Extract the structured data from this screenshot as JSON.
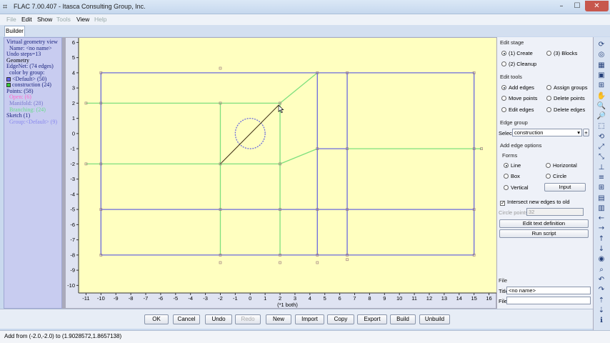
{
  "window": {
    "title": "FLAC 7.00.407 - Itasca Consulting Group, Inc.",
    "app_icon": "flac-app-icon",
    "minimize_glyph": "–",
    "maximize_glyph": "☐",
    "close_glyph": "✕"
  },
  "menu": [
    "File",
    "Edit",
    "Show",
    "Tools",
    "View",
    "Help"
  ],
  "menu_disabled": [
    "File",
    "Tools",
    "Help"
  ],
  "tabs": [
    "Builder"
  ],
  "left_panel": {
    "lines": [
      {
        "text": "Virtual geometry view",
        "color": "#1a237e"
      },
      {
        "text": "Name: <no name>",
        "color": "#1a237e",
        "indent": true
      },
      {
        "text": "Undo steps=13",
        "color": "#1a237e"
      },
      {
        "text": "Geometry",
        "color": "#000000"
      },
      {
        "text": "EdgeNet: (74 edges)",
        "color": "#1a237e"
      },
      {
        "text": "color by group:",
        "color": "#1a237e",
        "indent": true
      },
      {
        "text": "<Default> (50)",
        "color": "#1a237e",
        "swatch": "#6666ee"
      },
      {
        "text": "construction (24)",
        "color": "#1a237e",
        "swatch": "#33cc33"
      },
      {
        "text": "Points: (58)",
        "color": "#1a237e"
      },
      {
        "text": "Open: (6)",
        "color": "#ff66cc",
        "indent": true
      },
      {
        "text": "Manifold: (28)",
        "color": "#7777cc",
        "indent": true
      },
      {
        "text": "Branching: (24)",
        "color": "#66dd88",
        "indent": true
      },
      {
        "text": "Sketch (1)",
        "color": "#1a237e"
      },
      {
        "text": "Group:<Default> (9)",
        "color": "#8888ee",
        "indent": true
      }
    ]
  },
  "plot": {
    "x_ticks": [
      "-11",
      "-10",
      "-9",
      "-8",
      "-7",
      "-6",
      "-5",
      "-4",
      "-3",
      "-2",
      "-1",
      "0",
      "1",
      "2",
      "3",
      "4",
      "5",
      "6",
      "7",
      "8",
      "9",
      "10",
      "11",
      "12",
      "13",
      "14",
      "15",
      "16"
    ],
    "y_ticks": [
      "6",
      "5",
      "4",
      "3",
      "2",
      "1",
      "0",
      "-1",
      "-2",
      "-3",
      "-4",
      "-5",
      "-6",
      "-7",
      "-8",
      "-9",
      "-10"
    ],
    "x_note": "(*1 both)",
    "colors": {
      "background": "#ffffc0",
      "default_edge": "#6a6ade",
      "construction_edge": "#7ee07e",
      "sketch_line": "#3a2a10",
      "point_marker": "#a08080"
    }
  },
  "right_panel": {
    "edit_stage_title": "Edit stage",
    "edit_stage": [
      {
        "label": "(1) Create",
        "checked": true
      },
      {
        "label": "(3) Blocks",
        "checked": false
      },
      {
        "label": "(2) Cleanup",
        "checked": false
      }
    ],
    "edit_tools_title": "Edit tools",
    "edit_tools": [
      {
        "label": "Add edges",
        "checked": true
      },
      {
        "label": "Assign groups",
        "checked": false
      },
      {
        "label": "Move points",
        "checked": false
      },
      {
        "label": "Delete points",
        "checked": false
      },
      {
        "label": "Edit edges",
        "checked": false
      },
      {
        "label": "Delete edges",
        "checked": false
      }
    ],
    "edge_group_title": "Edge group",
    "select_label": "Select",
    "select_value": "construction",
    "add_button": "+",
    "add_edge_options_title": "Add edge options",
    "forms_title": "Forms",
    "forms": [
      {
        "label": "Line",
        "checked": true
      },
      {
        "label": "Horizontal",
        "checked": false
      },
      {
        "label": "Box",
        "checked": false
      },
      {
        "label": "Circle",
        "checked": false
      },
      {
        "label": "Vertical",
        "checked": false
      }
    ],
    "input_button": "Input",
    "intersect_label": "Intersect new edges to old",
    "intersect_checked": true,
    "circle_points_label": "Circle points",
    "circle_points_value": "32",
    "edit_text_button": "Edit text definition",
    "run_script_button": "Run script",
    "file_title": "File",
    "title_label": "Title",
    "title_value": "<no name>",
    "file_label": "File",
    "file_value": ""
  },
  "toolbar_icons": [
    "refresh-icon",
    "reset-view-icon",
    "view-icon",
    "grid-icon",
    "select-icon",
    "pan-icon",
    "zoom-in-icon",
    "zoom-out-icon",
    "zoom-box-icon",
    "rotate-icon",
    "fit-icon",
    "fit-all-icon",
    "axes-icon",
    "layer-icon",
    "grid-plot-icon",
    "mesh-icon",
    "table-icon",
    "arrow-left-icon",
    "arrow-right-icon",
    "up-arrow-icon",
    "down-arrow-icon",
    "target-icon",
    "search-icon",
    "undo-view-icon",
    "redo-view-icon",
    "up-icon",
    "down-icon",
    "info-icon"
  ],
  "toolbar_glyphs": [
    "⟳",
    "◎",
    "▦",
    "▣",
    "⊞",
    "✋",
    "🔍",
    "🔎",
    "⬚",
    "⟲",
    "⤢",
    "⤡",
    "⊥",
    "≡",
    "⊞",
    "▤",
    "▥",
    "←",
    "→",
    "↑",
    "↓",
    "◉",
    "⌕",
    "↶",
    "↷",
    "⇡",
    "⇣",
    "ℹ"
  ],
  "bottom_buttons": [
    {
      "label": "OK",
      "enabled": true
    },
    {
      "label": "Cancel",
      "enabled": true
    },
    {
      "label": "Undo",
      "enabled": true
    },
    {
      "label": "Redo",
      "enabled": false
    },
    {
      "label": "New",
      "enabled": true
    },
    {
      "label": "Import",
      "enabled": true
    },
    {
      "label": "Copy",
      "enabled": true
    },
    {
      "label": "Export",
      "enabled": true
    },
    {
      "label": "Build",
      "enabled": true
    },
    {
      "label": "Unbuild",
      "enabled": true
    }
  ],
  "status": "Add from (-2.0,-2.0) to (1.9028572,1.8657138)",
  "geometry": {
    "default_edges": [
      [
        [
          -10,
          4
        ],
        [
          15,
          4
        ]
      ],
      [
        [
          15,
          4
        ],
        [
          15,
          -8
        ]
      ],
      [
        [
          15,
          -8
        ],
        [
          -10,
          -8
        ]
      ],
      [
        [
          -10,
          -8
        ],
        [
          -10,
          4
        ]
      ],
      [
        [
          -10,
          -5
        ],
        [
          15,
          -5
        ]
      ],
      [
        [
          4.5,
          4
        ],
        [
          4.5,
          -8
        ]
      ],
      [
        [
          6.5,
          4
        ],
        [
          6.5,
          -8
        ]
      ],
      [
        [
          4.5,
          -1
        ],
        [
          6.5,
          -1
        ]
      ]
    ],
    "construction_edges": [
      [
        [
          -10,
          2
        ],
        [
          2,
          2
        ]
      ],
      [
        [
          -10,
          -2
        ],
        [
          2,
          -2
        ]
      ],
      [
        [
          -2,
          2
        ],
        [
          -2,
          -8
        ]
      ],
      [
        [
          2,
          2
        ],
        [
          2,
          -8
        ]
      ],
      [
        [
          2,
          2
        ],
        [
          4.5,
          4
        ]
      ],
      [
        [
          2,
          -2
        ],
        [
          4.5,
          -1
        ]
      ],
      [
        [
          6.5,
          -1
        ],
        [
          15,
          -1
        ]
      ],
      [
        [
          -10,
          2
        ],
        [
          -11,
          2
        ]
      ],
      [
        [
          -10,
          -2
        ],
        [
          -11,
          -2
        ]
      ],
      [
        [
          15,
          -1
        ],
        [
          15.5,
          -1
        ]
      ]
    ],
    "circle": {
      "cx": 0,
      "cy": 0,
      "r": 1
    },
    "sketch_line": [
      [
        -2,
        -2
      ],
      [
        1.9028572,
        1.8657138
      ]
    ],
    "points": [
      [
        -2,
        4.3
      ],
      [
        -2,
        -8.5
      ],
      [
        2,
        -8.5
      ],
      [
        4.5,
        -8.5
      ],
      [
        6.5,
        -8.3
      ],
      [
        -11,
        2
      ],
      [
        -11,
        -2
      ],
      [
        15.5,
        -1
      ],
      [
        2,
        2
      ],
      [
        -2,
        -2
      ],
      [
        -10,
        4
      ],
      [
        15,
        4
      ],
      [
        -10,
        -8
      ],
      [
        15,
        -8
      ],
      [
        -10,
        -5
      ],
      [
        15,
        -5
      ],
      [
        4.5,
        4
      ],
      [
        6.5,
        4
      ],
      [
        4.5,
        -1
      ],
      [
        6.5,
        -1
      ],
      [
        4.5,
        -5
      ],
      [
        6.5,
        -5
      ],
      [
        -2,
        -5
      ],
      [
        2,
        -5
      ],
      [
        -10,
        2
      ],
      [
        -10,
        -2
      ],
      [
        -2,
        2
      ],
      [
        2,
        -2
      ],
      [
        -2,
        -8
      ],
      [
        2,
        -8
      ],
      [
        4.5,
        -8
      ],
      [
        6.5,
        -8
      ],
      [
        15,
        -1
      ]
    ]
  }
}
